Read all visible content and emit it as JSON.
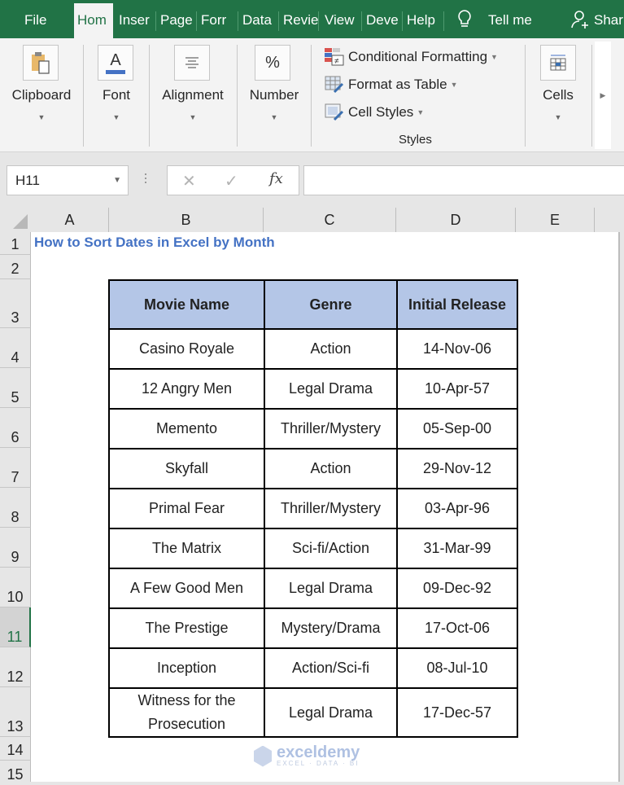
{
  "tabs": [
    {
      "label": "File",
      "active": false
    },
    {
      "label": "Hom",
      "active": true
    },
    {
      "label": "Inser",
      "active": false
    },
    {
      "label": "Page",
      "active": false
    },
    {
      "label": "Forr",
      "active": false
    },
    {
      "label": "Data",
      "active": false
    },
    {
      "label": "Revie",
      "active": false
    },
    {
      "label": "View",
      "active": false
    },
    {
      "label": "Deve",
      "active": false
    },
    {
      "label": "Help",
      "active": false
    }
  ],
  "tell_me": "Tell me",
  "share": "Shar",
  "ribbon": {
    "clipboard": "Clipboard",
    "font": "Font",
    "font_icon_letter": "A",
    "alignment": "Alignment",
    "number": "Number",
    "number_icon": "%",
    "conditional_formatting": "Conditional Formatting",
    "format_as_table": "Format as Table",
    "cell_styles": "Cell Styles",
    "styles": "Styles",
    "cells": "Cells",
    "accent_color": "#217346"
  },
  "formula_bar": {
    "name_box": "H11",
    "fx_label": "fx",
    "formula": ""
  },
  "columns": [
    "A",
    "B",
    "C",
    "D",
    "E"
  ],
  "rows": [
    "1",
    "2",
    "3",
    "4",
    "5",
    "6",
    "7",
    "8",
    "9",
    "10",
    "11",
    "12",
    "13",
    "14",
    "15"
  ],
  "selected_row": "11",
  "sheet": {
    "title": "How to Sort Dates in Excel by Month",
    "headers": [
      "Movie Name",
      "Genre",
      "Initial Release"
    ],
    "records": [
      [
        "Casino Royale",
        "Action",
        "14-Nov-06"
      ],
      [
        "12 Angry Men",
        "Legal Drama",
        "10-Apr-57"
      ],
      [
        "Memento",
        "Thriller/Mystery",
        "05-Sep-00"
      ],
      [
        "Skyfall",
        "Action",
        "29-Nov-12"
      ],
      [
        "Primal Fear",
        "Thriller/Mystery",
        "03-Apr-96"
      ],
      [
        "The Matrix",
        "Sci-fi/Action",
        "31-Mar-99"
      ],
      [
        "A Few Good Men",
        "Legal Drama",
        "09-Dec-92"
      ],
      [
        "The Prestige",
        "Mystery/Drama",
        "17-Oct-06"
      ],
      [
        "Inception",
        "Action/Sci-fi",
        "08-Jul-10"
      ],
      [
        "Witness for the Prosecution",
        "Legal Drama",
        "17-Dec-57"
      ]
    ],
    "header_fill": "#b4c6e7",
    "title_color": "#4472c4"
  },
  "watermark": {
    "name": "exceldemy",
    "tagline": "EXCEL · DATA · BI"
  }
}
